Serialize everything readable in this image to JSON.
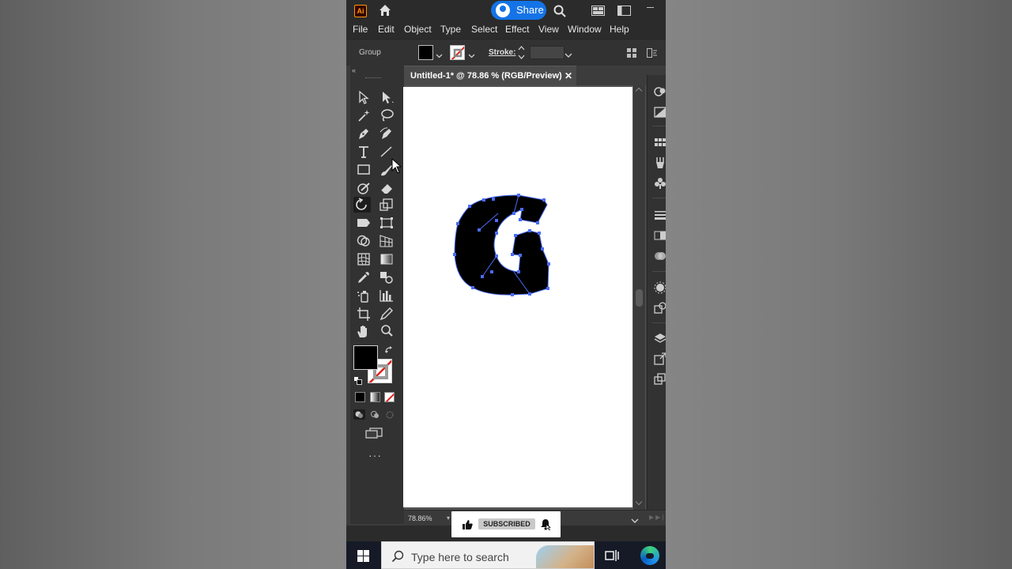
{
  "titlebar": {
    "app_logo": "Ai",
    "share_label": "Share",
    "icons": [
      "home-icon",
      "user-avatar-icon",
      "search-icon",
      "arrange-documents-icon",
      "panel-layout-icon",
      "minimize-icon"
    ]
  },
  "menubar": {
    "items": [
      "File",
      "Edit",
      "Object",
      "Type",
      "Select",
      "Effect",
      "View",
      "Window",
      "Help"
    ]
  },
  "controlbar": {
    "selection_label": "Group",
    "fill_color": "#000000",
    "stroke_color": "none",
    "stroke_label": "Stroke:",
    "stroke_value": ""
  },
  "document": {
    "tab_label": "Untitled-1* @ 78.86 % (RGB/Preview)",
    "close_glyph": "✕",
    "artwork": {
      "letter": "G",
      "fill": "#000000",
      "selection_color": "#4a6cf7"
    }
  },
  "statusbar": {
    "zoom": "78.86%"
  },
  "toolbar": {
    "collapse_glyph": "«",
    "more_glyph": "···",
    "tools": [
      "selection-tool",
      "direct-selection-tool",
      "magic-wand-tool",
      "lasso-tool",
      "pen-tool",
      "curvature-tool",
      "type-tool",
      "line-segment-tool",
      "rectangle-tool",
      "paintbrush-tool",
      "shaper-tool",
      "eraser-tool",
      "rotate-tool",
      "scale-tool",
      "width-tool",
      "free-transform-tool",
      "shape-builder-tool",
      "perspective-grid-tool",
      "mesh-tool",
      "gradient-tool",
      "eyedropper-tool",
      "blend-tool",
      "symbol-sprayer-tool",
      "column-graph-tool",
      "artboard-tool",
      "slice-tool",
      "hand-tool",
      "zoom-tool"
    ],
    "active_tool": "rotate-tool"
  },
  "overlay": {
    "subscribed_label": "SUBSCRIBED"
  },
  "taskbar": {
    "search_placeholder": "Type here to search",
    "colors": {
      "bar": "#161a26",
      "search_bg": "#f1f1f1"
    }
  },
  "colors": {
    "app_bg": "#3c3c3c",
    "titlebar": "#2b2b2b",
    "accent": "#1473e6",
    "logo": "#ff9a00"
  }
}
